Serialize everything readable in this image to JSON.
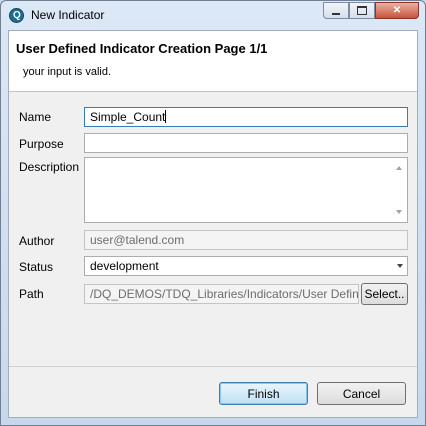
{
  "window": {
    "title": "New Indicator",
    "app_icon": "talend-q-icon",
    "app_icon_letter": "Q"
  },
  "window_controls": {
    "minimize": "minimize-icon",
    "maximize": "maximize-icon",
    "close": "close-icon",
    "close_glyph": "✕"
  },
  "header": {
    "title": "User Defined Indicator Creation Page 1/1",
    "message": "your input is valid."
  },
  "form": {
    "name_label": "Name",
    "name_value": "Simple_Count",
    "purpose_label": "Purpose",
    "purpose_value": "",
    "description_label": "Description",
    "description_value": "",
    "author_label": "Author",
    "author_value": "user@talend.com",
    "status_label": "Status",
    "status_value": "development",
    "path_label": "Path",
    "path_value": "/DQ_DEMOS/TDQ_Libraries/Indicators/User Define",
    "select_label": "Select.."
  },
  "buttons": {
    "finish": "Finish",
    "cancel": "Cancel"
  }
}
